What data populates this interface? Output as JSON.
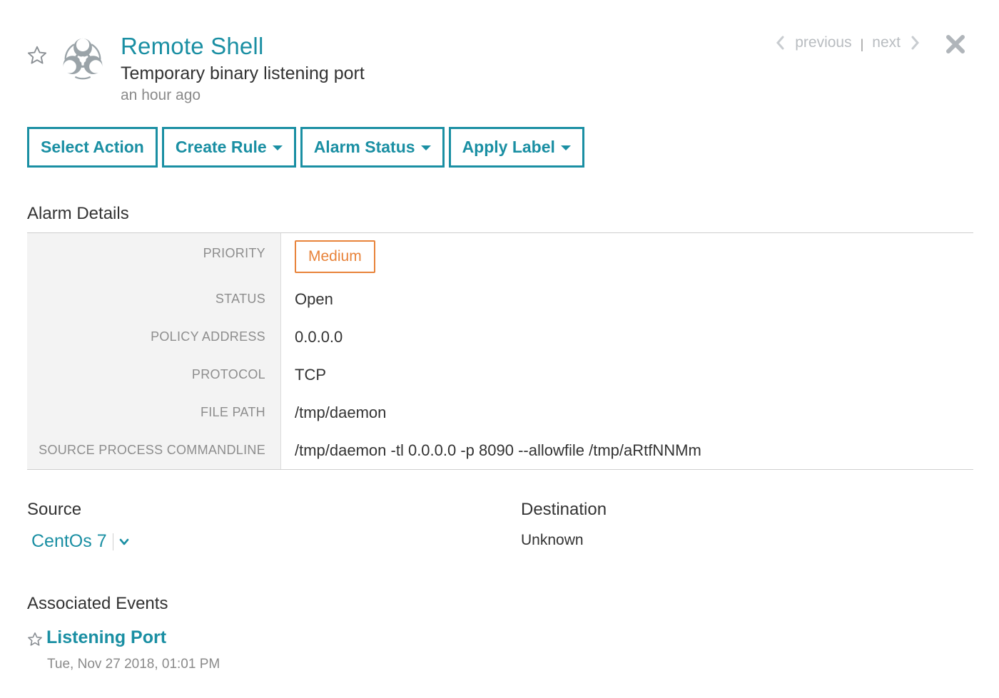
{
  "header": {
    "title": "Remote Shell",
    "subtitle": "Temporary binary listening port",
    "timestamp": "an hour ago",
    "icon": "biohazard-icon"
  },
  "pager": {
    "previous_label": "previous",
    "separator": "|",
    "next_label": "next"
  },
  "actions": {
    "select_action": "Select Action",
    "create_rule": "Create Rule",
    "alarm_status": "Alarm Status",
    "apply_label": "Apply Label"
  },
  "alarm_details": {
    "title": "Alarm Details",
    "rows": [
      {
        "label": "PRIORITY",
        "value": "Medium"
      },
      {
        "label": "STATUS",
        "value": "Open"
      },
      {
        "label": "POLICY ADDRESS",
        "value": "0.0.0.0"
      },
      {
        "label": "PROTOCOL",
        "value": "TCP"
      },
      {
        "label": "FILE PATH",
        "value": "/tmp/daemon"
      },
      {
        "label": "SOURCE PROCESS COMMANDLINE",
        "value": "/tmp/daemon -tl 0.0.0.0 -p 8090 --allowfile /tmp/aRtfNNMm"
      }
    ]
  },
  "source": {
    "title": "Source",
    "host": "CentOs 7"
  },
  "destination": {
    "title": "Destination",
    "value": "Unknown"
  },
  "associated_events": {
    "title": "Associated Events",
    "items": [
      {
        "name": "Listening Port",
        "date": "Tue, Nov 27 2018, 01:01 PM"
      }
    ]
  },
  "colors": {
    "accent": "#1a8fa3",
    "priority_medium": "#e8833a",
    "muted": "#8a8a8a"
  }
}
